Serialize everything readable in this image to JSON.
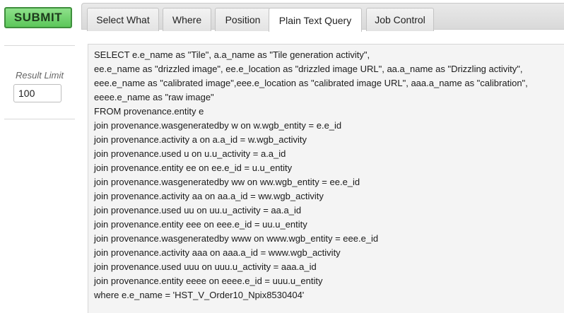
{
  "submit_label": "SUBMIT",
  "result_limit": {
    "label": "Result Limit",
    "value": "100"
  },
  "tabs": [
    {
      "label": "Select What"
    },
    {
      "label": "Where"
    },
    {
      "label": "Position"
    },
    {
      "label": "Plain Text Query",
      "active": true
    },
    {
      "label": "Job Control"
    }
  ],
  "query_lines": [
    "SELECT e.e_name as \"Tile\", a.a_name as \"Tile generation activity\",",
    "ee.e_name as \"drizzled image\", ee.e_location as \"drizzled image URL\", aa.a_name as \"Drizzling activity\",",
    "eee.e_name as \"calibrated image\",eee.e_location as \"calibrated image URL\", aaa.a_name as \"calibration\",",
    "eeee.e_name as \"raw image\"",
    "FROM provenance.entity e",
    "join provenance.wasgeneratedby w on w.wgb_entity = e.e_id",
    "join provenance.activity a on a.a_id = w.wgb_activity",
    "join provenance.used u on u.u_activity = a.a_id",
    "join provenance.entity ee on ee.e_id = u.u_entity",
    "join provenance.wasgeneratedby ww on ww.wgb_entity = ee.e_id",
    "join provenance.activity aa on aa.a_id = ww.wgb_activity",
    "join provenance.used uu on uu.u_activity = aa.a_id",
    "join provenance.entity eee on eee.e_id = uu.u_entity",
    "join provenance.wasgeneratedby www on www.wgb_entity = eee.e_id",
    "join provenance.activity aaa on aaa.a_id = www.wgb_activity",
    "join provenance.used uuu on uuu.u_activity = aaa.a_id",
    "join provenance.entity eeee on eeee.e_id = uuu.u_entity",
    "where e.e_name = 'HST_V_Order10_Npix8530404'"
  ]
}
